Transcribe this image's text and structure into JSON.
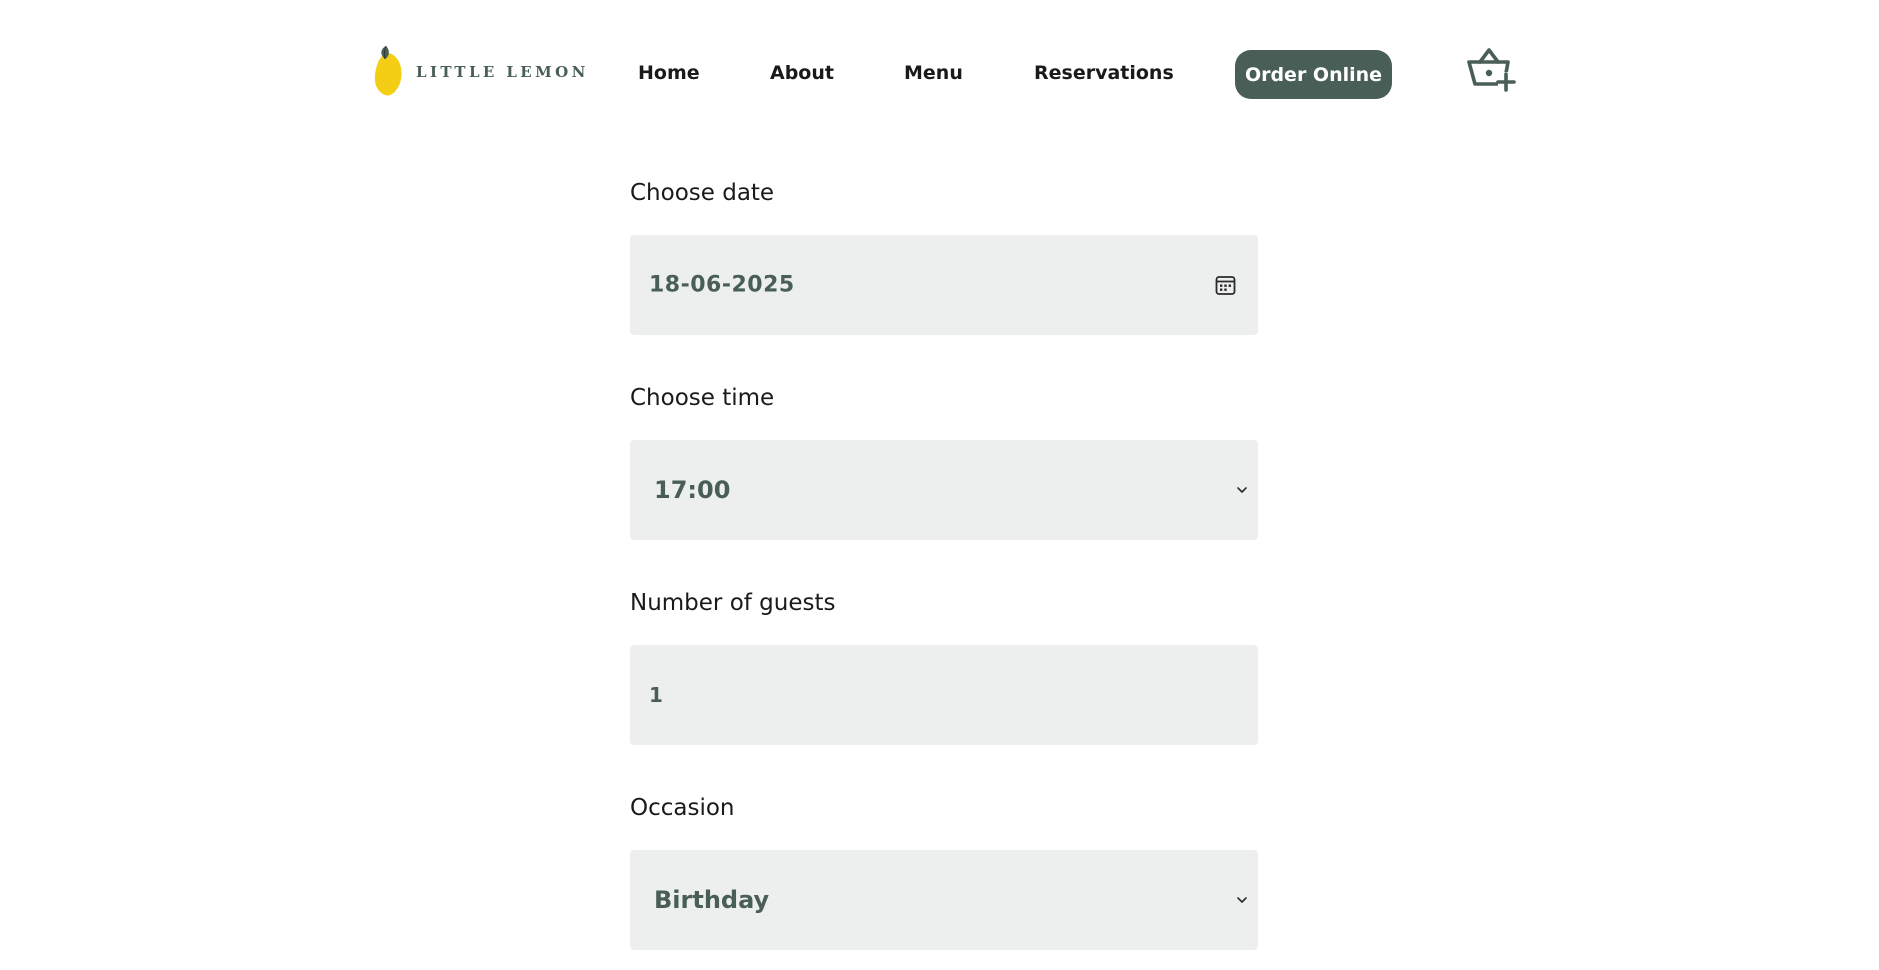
{
  "brand": {
    "name": "LITTLE LEMON",
    "colors": {
      "primary": "#495e57",
      "accent": "#f4ce14",
      "field_bg": "#edefee"
    }
  },
  "nav": {
    "items": [
      {
        "label": "Home"
      },
      {
        "label": "About"
      },
      {
        "label": "Menu"
      },
      {
        "label": "Reservations"
      }
    ],
    "order_button": "Order Online",
    "cart_icon": "basket-add-icon"
  },
  "form": {
    "date": {
      "label": "Choose date",
      "value": "18-06-2025",
      "icon": "calendar-icon"
    },
    "time": {
      "label": "Choose time",
      "value": "17:00",
      "icon": "chevron-down-icon"
    },
    "guests": {
      "label": "Number of guests",
      "value": "1"
    },
    "occasion": {
      "label": "Occasion",
      "value": "Birthday",
      "icon": "chevron-down-icon"
    }
  }
}
